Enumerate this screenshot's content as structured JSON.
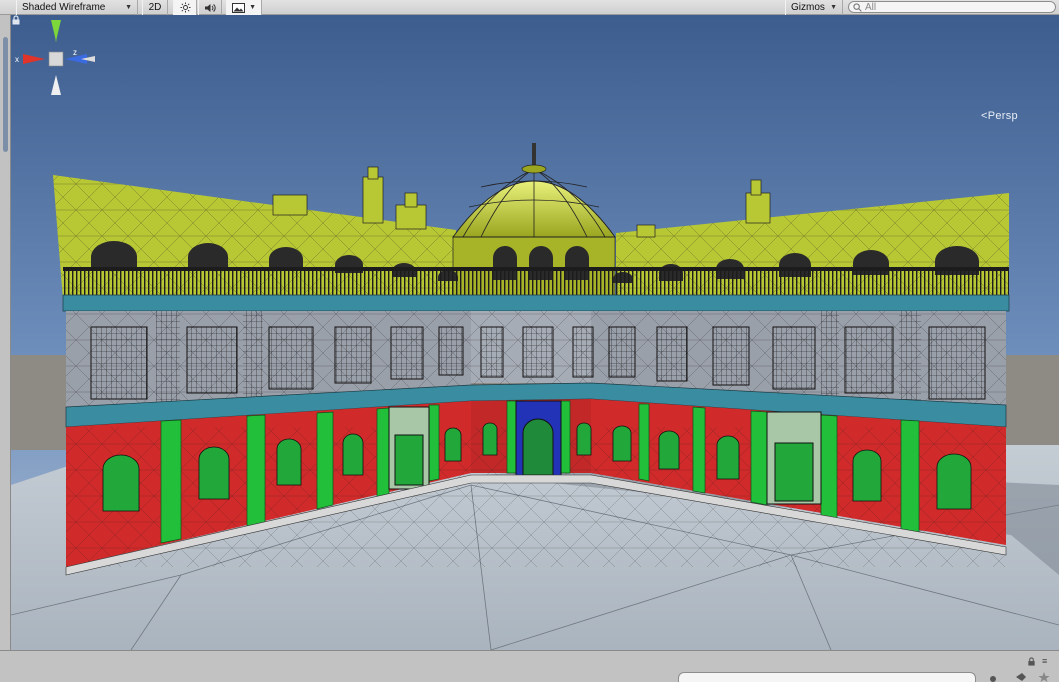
{
  "toolbar": {
    "draw_mode": "Shaded Wireframe",
    "mode_2d": "2D",
    "gizmos_label": "Gizmos",
    "search_placeholder": "All",
    "icons": [
      "sun-icon",
      "speaker-icon",
      "image-icon",
      "dropdown-icon"
    ]
  },
  "viewport": {
    "projection_label": "Persp",
    "axis_labels": {
      "x": "x",
      "z": "z"
    },
    "axis_colors": {
      "x": "#e0342a",
      "y": "#7dd63a",
      "z": "#3a6be0"
    },
    "scene_colors": {
      "sky_top": "#3d5d8f",
      "sky_bottom": "#a9bcd2",
      "ground": "#b8c2cc",
      "roof": "#b8c734",
      "cornice": "#3a8ca0",
      "upper_floor": "#9aa0aa",
      "ground_floor_wall": "#d12a2a",
      "pilaster": "#22c03a",
      "entrance": "#2233b8"
    }
  },
  "bottom": {
    "icons": [
      "lock-icon",
      "menu-icon",
      "tag-icon",
      "star-icon"
    ]
  }
}
